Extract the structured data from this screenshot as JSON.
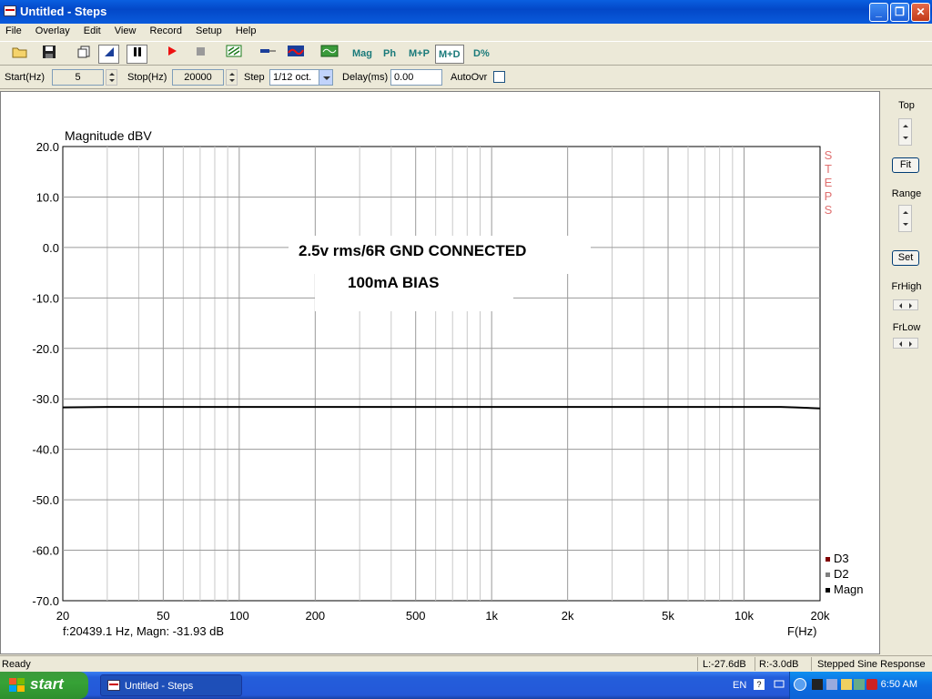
{
  "window": {
    "title": "Untitled - Steps",
    "minimize": "_",
    "maximize": "❐",
    "close": "✕"
  },
  "menu": [
    "File",
    "Overlay",
    "Edit",
    "View",
    "Record",
    "Setup",
    "Help"
  ],
  "toolbar": {
    "mag": "Mag",
    "ph": "Ph",
    "mp": "M+P",
    "md": "M+D",
    "dpct": "D%"
  },
  "params": {
    "start_label": "Start(Hz)",
    "start_value": "5",
    "stop_label": "Stop(Hz)",
    "stop_value": "20000",
    "step_label": "Step",
    "step_value": "1/12 oct.",
    "delay_label": "Delay(ms)",
    "delay_value": "0.00",
    "autoovr_label": "AutoOvr"
  },
  "right_panel": {
    "top": "Top",
    "fit": "Fit",
    "range": "Range",
    "set": "Set",
    "frhigh": "FrHigh",
    "frlow": "FrLow"
  },
  "chart_data": {
    "type": "line",
    "ylabel": "Magnitude dBV",
    "xlabel": "F(Hz)",
    "xscale": "log",
    "xlim": [
      20,
      20000
    ],
    "ylim": [
      -70,
      20
    ],
    "grid": true,
    "y_ticks": [
      "20.0",
      "10.0",
      "0.0",
      "-10.0",
      "-20.0",
      "-30.0",
      "-40.0",
      "-50.0",
      "-60.0",
      "-70.0"
    ],
    "x_ticks": [
      {
        "value": 20,
        "label": "20"
      },
      {
        "value": 50,
        "label": "50"
      },
      {
        "value": 100,
        "label": "100"
      },
      {
        "value": 200,
        "label": "200"
      },
      {
        "value": 500,
        "label": "500"
      },
      {
        "value": 1000,
        "label": "1k"
      },
      {
        "value": 2000,
        "label": "2k"
      },
      {
        "value": 5000,
        "label": "5k"
      },
      {
        "value": 10000,
        "label": "10k"
      },
      {
        "value": 20000,
        "label": "20k"
      }
    ],
    "annotations": [
      "2.5v rms/6R GND CONNECTED",
      "100mA BIAS"
    ],
    "brand": "STEPS",
    "legend": [
      {
        "name": "D3",
        "color": "#800000"
      },
      {
        "name": "D2",
        "color": "#808080"
      },
      {
        "name": "Magn",
        "color": "#000000"
      }
    ],
    "legend_position": "bottom-right",
    "cursor_readout": "f:20439.1 Hz, Magn: -31.93 dB",
    "series": [
      {
        "name": "Magn",
        "color": "#000000",
        "x": [
          20,
          30,
          50,
          100,
          200,
          500,
          1000,
          2000,
          5000,
          10000,
          14000,
          16000,
          20000
        ],
        "y": [
          -31.7,
          -31.6,
          -31.6,
          -31.6,
          -31.6,
          -31.6,
          -31.6,
          -31.6,
          -31.6,
          -31.6,
          -31.6,
          -31.7,
          -31.9
        ]
      }
    ]
  },
  "status": {
    "ready": "Ready",
    "left": "L:-27.6dB",
    "right": "R:-3.0dB",
    "mode": "Stepped Sine Response"
  },
  "taskbar": {
    "start": "start",
    "task": "Untitled - Steps",
    "lang": "EN",
    "clock": "6:50 AM"
  }
}
